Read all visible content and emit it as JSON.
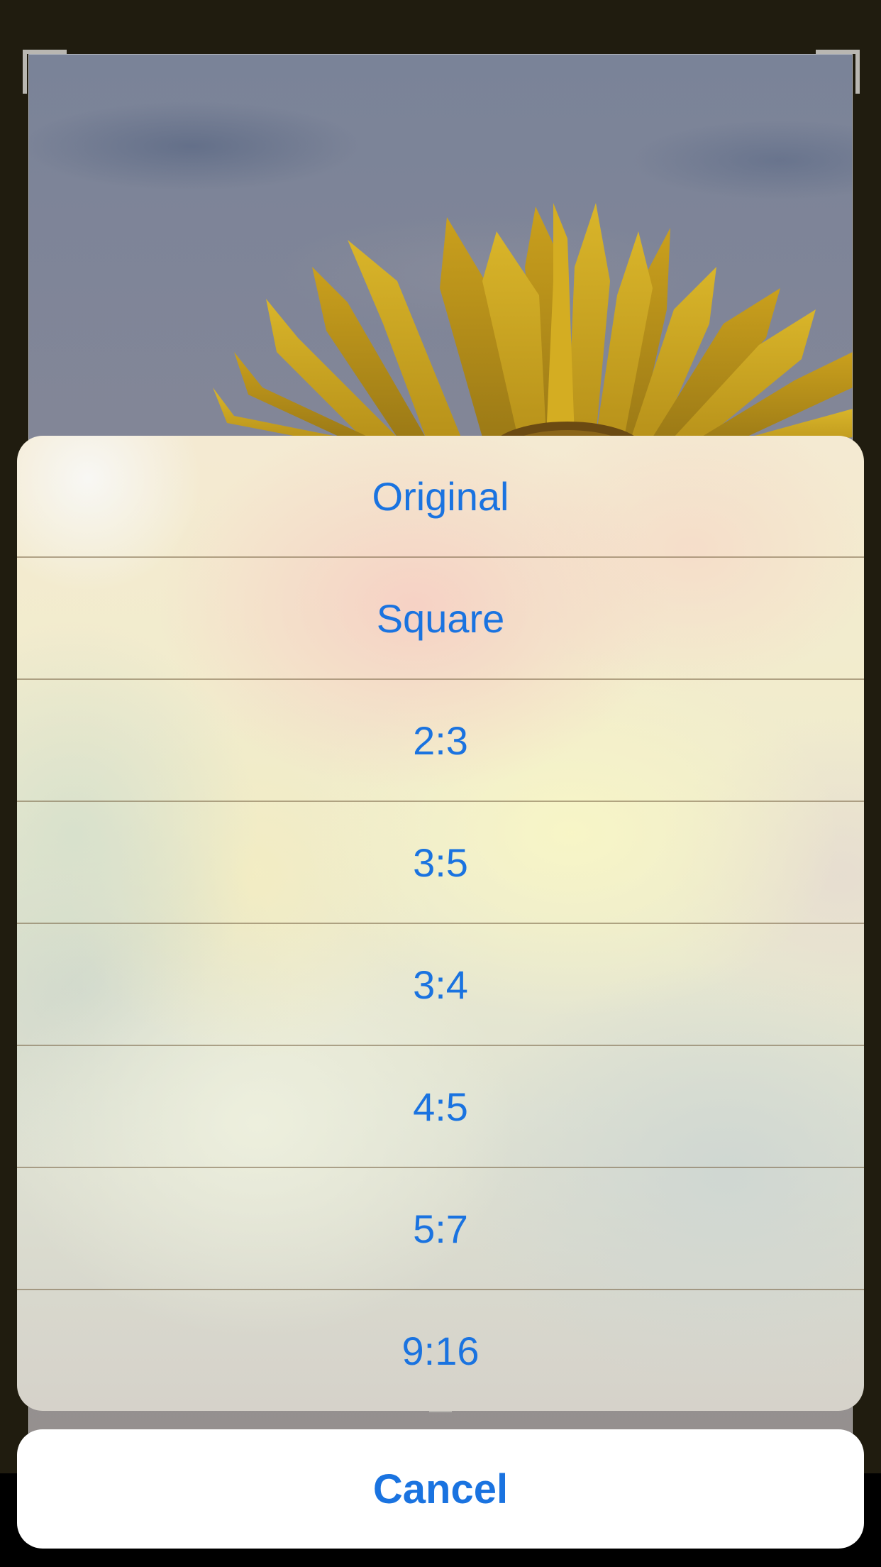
{
  "photo": {
    "subject": "sunflower"
  },
  "action_sheet": {
    "options": [
      {
        "label": "Original"
      },
      {
        "label": "Square"
      },
      {
        "label": "2:3"
      },
      {
        "label": "3:5"
      },
      {
        "label": "3:4"
      },
      {
        "label": "4:5"
      },
      {
        "label": "5:7"
      },
      {
        "label": "9:16"
      }
    ],
    "cancel_label": "Cancel",
    "accent_color": "#1a73e0"
  }
}
